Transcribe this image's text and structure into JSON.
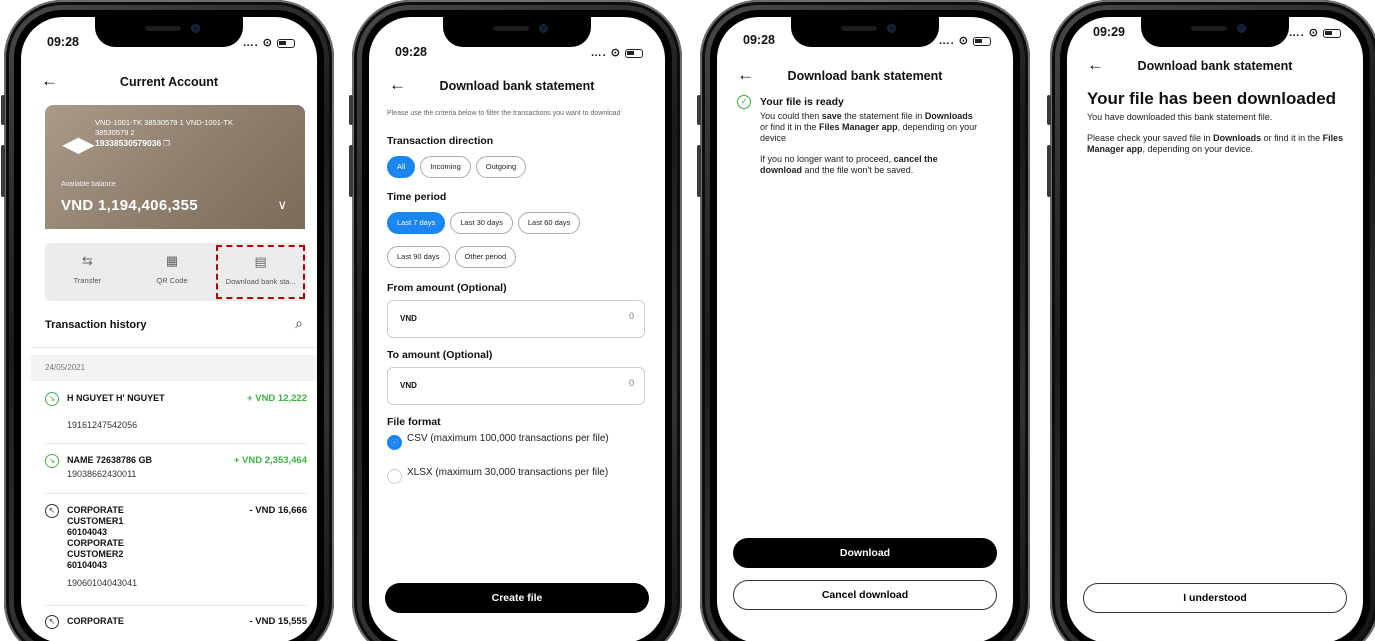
{
  "phones": [
    {
      "time": "09:28",
      "title": "Current Account",
      "card": {
        "account_line1": "VND-1001-TK 38530579 1 VND-1001-TK 38530579 2",
        "account_number": "19338530579036",
        "balance_label": "Available balance",
        "balance": "VND 1,194,406,355"
      },
      "actions": [
        {
          "label": "Transfer",
          "icon": "transfer-icon"
        },
        {
          "label": "QR Code",
          "icon": "qr-code-icon"
        },
        {
          "label": "Download bank sta...",
          "icon": "document-icon"
        }
      ],
      "history_title": "Transaction history",
      "date": "24/05/2021",
      "transactions": [
        {
          "name": "H NGUYET H' NGUYET",
          "number": "19161247542056",
          "amount": "+ VND 12,222",
          "direction": "in"
        },
        {
          "name": "NAME 72638786 GB",
          "number": "19038662430011",
          "amount": "+ VND 2,353,464",
          "direction": "in"
        },
        {
          "name": "CORPORATE CUSTOMER1 60104043 CORPORATE CUSTOMER2 60104043",
          "number": "19060104043041",
          "amount": "- VND 16,666",
          "direction": "out"
        },
        {
          "name": "CORPORATE",
          "number": "",
          "amount": "- VND 15,555",
          "direction": "out"
        }
      ]
    },
    {
      "time": "09:28",
      "title": "Download bank statement",
      "hint": "Please use the criteria below to filter the transactions you want to download",
      "direction_label": "Transaction direction",
      "direction_options": [
        "All",
        "Incoming",
        "Outgoing"
      ],
      "period_label": "Time period",
      "period_options_row1": [
        "Last 7 days",
        "Last 30 days",
        "Last 60 days"
      ],
      "period_options_row2": [
        "Last 90 days",
        "Other period"
      ],
      "from_label": "From amount (Optional)",
      "to_label": "To amount (Optional)",
      "currency": "VND",
      "amount_placeholder": "0",
      "format_label": "File format",
      "format_options": [
        "CSV (maximum 100,000 transactions per file)",
        "XLSX (maximum 30,000 transactions per file)"
      ],
      "create_button": "Create file"
    },
    {
      "time": "09:28",
      "title": "Download bank statement",
      "ready_title": "Your file is ready",
      "ready_p1_a": "You could then ",
      "ready_p1_b": "save",
      "ready_p1_c": " the statement file in ",
      "ready_p1_d": "Downloads",
      "ready_p1_e": " or find it in the ",
      "ready_p1_f": "Files Manager app",
      "ready_p1_g": ", depending on your device",
      "ready_p2_a": "If you no longer want to proceed, ",
      "ready_p2_b": "cancel the download",
      "ready_p2_c": " and the file won't be saved.",
      "download_button": "Download",
      "cancel_button": "Cancel download"
    },
    {
      "time": "09:29",
      "title": "Download bank statement",
      "heading": "Your file has been downloaded",
      "subtitle": "You have downloaded this bank statement file.",
      "body_a": "Please check your saved file in ",
      "body_b": "Downloads",
      "body_c": " or find it in the ",
      "body_d": "Files Manager app",
      "body_e": ", depending on your device.",
      "ok_button": "I understood"
    }
  ],
  "colors": {
    "accent": "#1b85f2",
    "positive": "#3cb043",
    "highlight": "#b00000"
  }
}
